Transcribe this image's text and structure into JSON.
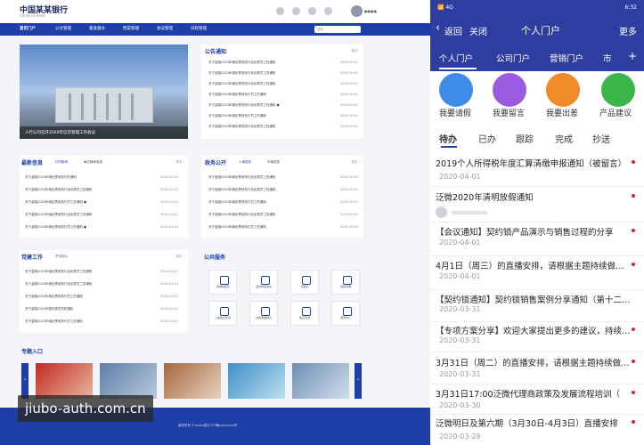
{
  "desktop": {
    "bank_name": "中国某某银行",
    "bank_en": "China xx Bank",
    "user_name": "●●●●",
    "nav": [
      "首页门户",
      "公文管理",
      "督查督办",
      "档案管理",
      "会议管理",
      "日程管理"
    ],
    "search_placeholder": "搜索",
    "banner_caption": "人行公司召开2020年信贷管理工作会议",
    "notice": {
      "title": "公告通知",
      "more": "更多 ›",
      "rows": [
        {
          "text": "关于金融2020年增优贯彻执行及优秀员工的通知",
          "date": "2020-05-01"
        },
        {
          "text": "关于金融2020年增优贯彻执行及优秀员工的通知",
          "date": "2020-05-01"
        },
        {
          "text": "关于金融2020年增优贯彻执行及优秀员工的通知",
          "date": "2020-05-01"
        },
        {
          "text": "关于金融2020年增优贯彻执行员工的通知",
          "date": "2020-05-01"
        },
        {
          "text": "关于金融2020年增优贯彻执行及优秀员工的通知 ●",
          "date": "2020-05-01"
        },
        {
          "text": "关于金融2020年增优贯彻执行员工的通知",
          "date": "2020-05-01"
        },
        {
          "text": "关于金融2020年增优贯彻执行及优秀员工的通知",
          "date": "2020-05-01"
        }
      ]
    },
    "news": {
      "title": "最新信息",
      "tabs": [
        "行内新闻",
        "每日媒体信息"
      ],
      "more": "更多 ›",
      "rows": [
        {
          "text": "关于金融2020年增优贯彻执行的通知",
          "date": "2020-05-01"
        },
        {
          "text": "关于金融2020年增优贯彻执行及优秀员工的通知",
          "date": "2020-05-01"
        },
        {
          "text": "关于金融2020年增优贯彻执行员工的通知 ●",
          "date": "2020-05-01"
        },
        {
          "text": "关于金融2020年增优贯彻执行及优秀员工的通知",
          "date": "2020-05-01"
        },
        {
          "text": "关于金融2020年增优贯彻执行员工的通知 ●",
          "date": "2020-05-01"
        }
      ]
    },
    "gov": {
      "title": "政务公开",
      "tabs": [
        "人事信息",
        "外事信息"
      ],
      "more": "更多 ›",
      "rows": [
        {
          "text": "关于金融2020年增优贯彻执行及优秀员工的通知",
          "date": "2020-05-01"
        },
        {
          "text": "关于金融2020年增优贯彻执行及优秀员工的通知",
          "date": "2020-05-01"
        },
        {
          "text": "关于金融2020年增优贯彻执行员工的通知",
          "date": "2020-05-01"
        },
        {
          "text": "关于金融2020年增优贯彻执行及优秀员工的通知",
          "date": "2020-05-01"
        },
        {
          "text": "关于金融2020年增优贯彻执行员工的通知",
          "date": "2020-05-01"
        }
      ]
    },
    "party": {
      "title": "党建工作",
      "tabs": [
        "不忘初心"
      ],
      "more": "更多 ›",
      "rows": [
        {
          "text": "关于金融2020年增优贯彻执行及优秀员工的通知",
          "date": "2020-05-01"
        },
        {
          "text": "关于金融2020年增优贯彻执行及优秀员工的通知",
          "date": "2020-05-01"
        },
        {
          "text": "关于金融2020年增优贯彻执行员工的通知",
          "date": "2020-05-01"
        },
        {
          "text": "关于金融2020年度优秀党员的通知",
          "date": "2020-05-01"
        },
        {
          "text": "关于金融2020年增优贯彻执行员工的通知",
          "date": "2020-05-01"
        }
      ]
    },
    "services": {
      "title": "公共服务",
      "items": [
        "法规制度库",
        "最新制度动态",
        "周报表",
        "档案管理",
        "人事信息查询",
        "请求审理报表",
        "信息查询",
        "报告中心"
      ]
    },
    "topics_title": "专题入口",
    "footer_text": "版权所有 ©xxxxx银行 ICP备xxxxxxxx号"
  },
  "watermark": "jiubo-auth.com.cn",
  "mobile": {
    "status": {
      "left": "📶 4G",
      "time": "6:32"
    },
    "back": "返回",
    "close": "关闭",
    "title": "个人门户",
    "more": "更多",
    "portal_tabs": [
      "个人门户",
      "公司门户",
      "营销门户",
      "市"
    ],
    "add": "+",
    "actions": [
      {
        "label": "我要请假",
        "color": "#3f8bea"
      },
      {
        "label": "我要留言",
        "color": "#9b5be0"
      },
      {
        "label": "我要出差",
        "color": "#f08a2a"
      },
      {
        "label": "产品建议",
        "color": "#3bb44a"
      }
    ],
    "task_tabs": [
      "待办",
      "已办",
      "跟踪",
      "完成",
      "抄送"
    ],
    "items": [
      {
        "title": "2019个人所得税年度汇算清缴申报通知（被留言）",
        "date": "2020-04-01"
      },
      {
        "title": "泛微2020年清明放假通知",
        "date": ""
      },
      {
        "title": "【会议通知】契约锁产品演示与销售过程的分享",
        "date": "2020-04-01"
      },
      {
        "title": "4月1日（周三）的直播安排，请根据主题持续做…",
        "date": "2020-04-01"
      },
      {
        "title": "【契约锁通知】契约锁销售案例分享通知（第十二…",
        "date": "2020-03-31"
      },
      {
        "title": "【专项方案分享】欢迎大家提出更多的建议，持续…",
        "date": "2020-03-31"
      },
      {
        "title": "3月31日（周二）的直播安排，请根据主题持续做…",
        "date": "2020-03-31"
      },
      {
        "title": "3月31日17:00泛微代理商政策及发展流程培训（",
        "date": "2020-03-30"
      },
      {
        "title": "泛微明日及第六期（3月30日-4月3日）直播安排",
        "date": "2020-03-29"
      }
    ]
  }
}
